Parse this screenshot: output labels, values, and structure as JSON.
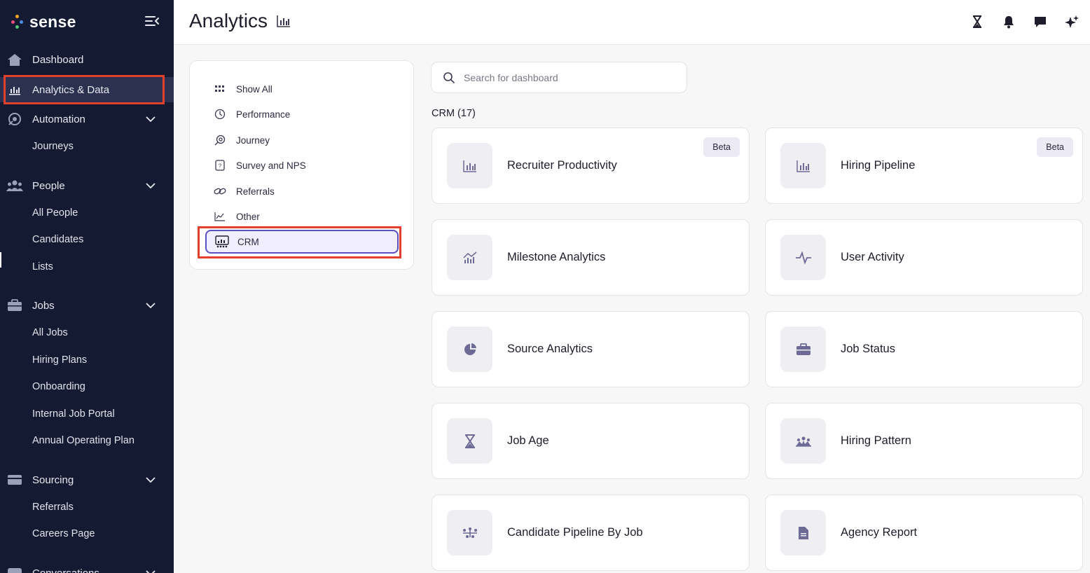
{
  "brand": {
    "name": "sense"
  },
  "sidebar": {
    "dashboard": "Dashboard",
    "analytics": "Analytics & Data",
    "automation": "Automation",
    "journeys": "Journeys",
    "people": "People",
    "people_items": [
      "All People",
      "Candidates",
      "Lists"
    ],
    "jobs": "Jobs",
    "jobs_items": [
      "All Jobs",
      "Hiring Plans",
      "Onboarding",
      "Internal Job Portal",
      "Annual Operating Plan"
    ],
    "sourcing": "Sourcing",
    "sourcing_items": [
      "Referrals",
      "Careers Page"
    ],
    "conversations": "Conversations"
  },
  "header": {
    "title": "Analytics",
    "icons": [
      "hourglass-icon",
      "bell-icon",
      "chat-icon",
      "sparkle-icon"
    ]
  },
  "filters": {
    "items": [
      "Show All",
      "Performance",
      "Journey",
      "Survey and NPS",
      "Referrals",
      "Other"
    ],
    "selected": "CRM"
  },
  "search": {
    "placeholder": "Search for dashboard"
  },
  "section": {
    "label": "CRM (17)"
  },
  "dashboards": [
    {
      "name": "Recruiter Productivity",
      "badge": "Beta",
      "icon": "bar-chart-icon"
    },
    {
      "name": "Hiring Pipeline",
      "badge": "Beta",
      "icon": "bar-chart-icon"
    },
    {
      "name": "Milestone Analytics",
      "badge": "",
      "icon": "trend-chart-icon"
    },
    {
      "name": "User Activity",
      "badge": "",
      "icon": "pulse-icon"
    },
    {
      "name": "Source Analytics",
      "badge": "",
      "icon": "pie-chart-icon"
    },
    {
      "name": "Job Status",
      "badge": "",
      "icon": "briefcase-icon"
    },
    {
      "name": "Job Age",
      "badge": "",
      "icon": "hourglass-icon"
    },
    {
      "name": "Hiring Pattern",
      "badge": "",
      "icon": "hiring-pattern-icon"
    },
    {
      "name": "Candidate Pipeline By Job",
      "badge": "",
      "icon": "pipeline-icon"
    },
    {
      "name": "Agency Report",
      "badge": "",
      "icon": "document-icon"
    }
  ],
  "colors": {
    "sidebar_bg": "#151a33",
    "highlight": "#e0402c",
    "accent": "#5a4fc4",
    "icon": "#6e6a96"
  }
}
